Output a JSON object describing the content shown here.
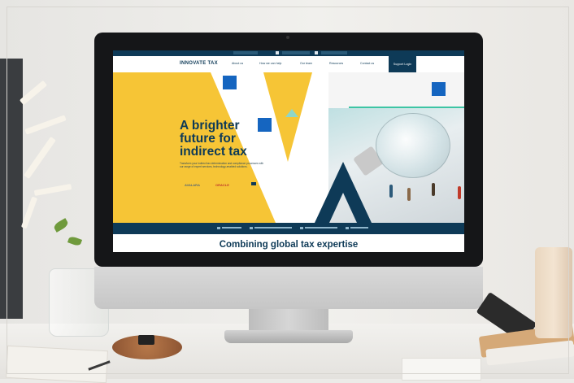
{
  "site": {
    "topbar_items": [
      "",
      "",
      ""
    ],
    "logo": "INNOVATE TAX",
    "nav": [
      "About us",
      "How we can help",
      "Our team",
      "Resources",
      "Contact us"
    ],
    "cta": "Support Login",
    "hero": {
      "title": "A brighter\nfuture for\nindirect tax",
      "body": "Transform your indirect tax determination and compliance processes with our range of expert services, technology-enabled solutions.",
      "partners": [
        "AVALARA",
        "ORACLE",
        ""
      ]
    },
    "features": [
      "",
      "",
      "",
      ""
    ],
    "section_title": "Combining global tax expertise"
  },
  "colors": {
    "navy": "#0e3a57",
    "yellow": "#f6c536",
    "teal": "#3dc5a4",
    "blue_square": "#1565c0"
  }
}
